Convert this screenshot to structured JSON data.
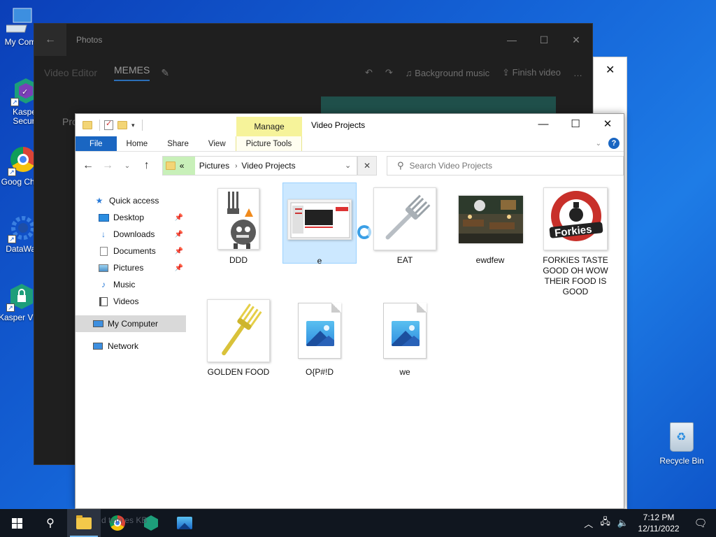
{
  "desktop": {
    "icons": [
      {
        "label": "My Com"
      },
      {
        "label": "Kasper Securit"
      },
      {
        "label": "Goog Chror"
      },
      {
        "label": "DataWag"
      },
      {
        "label": "Kasper VPN"
      }
    ],
    "recycle_bin": "Recycle Bin"
  },
  "photos": {
    "title": "Photos",
    "video_editor": "Video Editor",
    "current": "MEMES",
    "background_music": "Background music",
    "finish_video": "Finish video",
    "more": "…",
    "side_label": "Pro"
  },
  "explorer": {
    "title": "Video Projects",
    "manage_tab": "Manage",
    "ribbon_tabs": [
      "File",
      "Home",
      "Share",
      "View",
      "Picture Tools"
    ],
    "address": {
      "overflow": "«",
      "crumbs": [
        "Pictures",
        "Video Projects"
      ]
    },
    "search_placeholder": "Search Video Projects",
    "nav": {
      "quick_access": "Quick access",
      "pinned": [
        "Desktop",
        "Downloads",
        "Documents",
        "Pictures"
      ],
      "unpinned": [
        "Music",
        "Videos"
      ],
      "my_computer": "My Computer",
      "network": "Network"
    },
    "items": [
      {
        "name": "DDD",
        "kind": "robot-image"
      },
      {
        "name": "e",
        "kind": "screenshot-image",
        "selected": true
      },
      {
        "name": "EAT",
        "kind": "fork-image"
      },
      {
        "name": "ewdfew",
        "kind": "restaurant-photo"
      },
      {
        "name": "FORKIES TASTE GOOD OH WOW THEIR FOOD IS GOOD",
        "kind": "forkies-logo"
      },
      {
        "name": "GOLDEN FOOD",
        "kind": "golden-fork-image"
      },
      {
        "name": "O{P#!D",
        "kind": "generic-image-file"
      },
      {
        "name": "we",
        "kind": "generic-image-file"
      }
    ]
  },
  "taskbar": {
    "ghost_text": "d  tem  es  KB",
    "time": "7:12 PM",
    "date": "12/11/2022"
  },
  "colors": {
    "accent": "#1a66c2",
    "manage_highlight": "#f6f39a",
    "selection": "#cce8ff",
    "address_highlight": "#c8f0b9"
  }
}
